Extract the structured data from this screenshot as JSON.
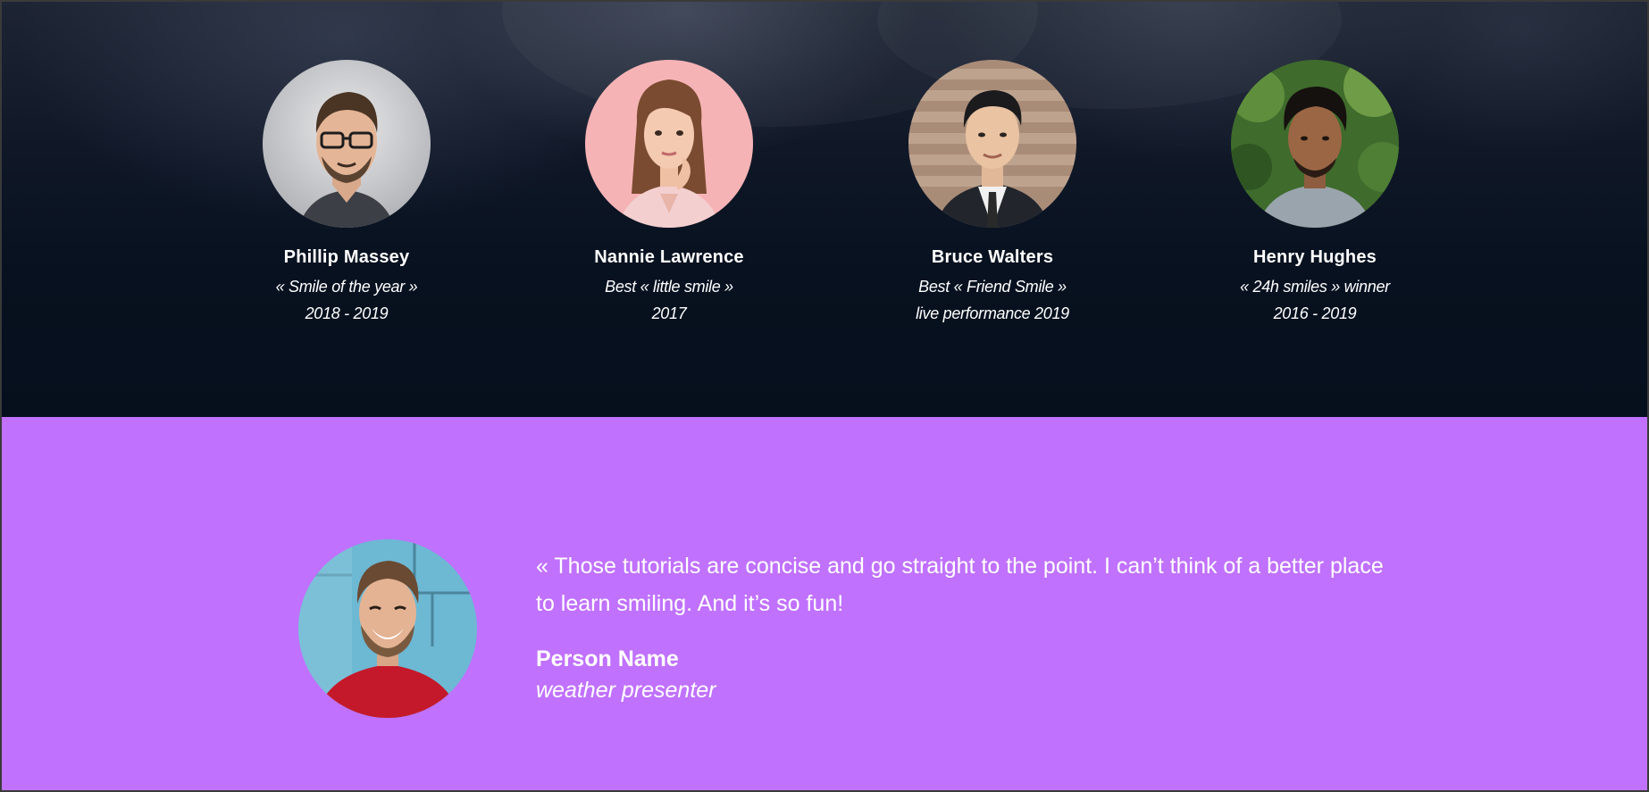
{
  "team": {
    "members": [
      {
        "name": "Phillip Massey",
        "line1": "« Smile of the year »",
        "line2": "2018 - 2019",
        "avatar": "man-with-glasses-photo"
      },
      {
        "name": "Nannie Lawrence",
        "line1": "Best « little smile »",
        "line2": "2017",
        "avatar": "woman-pink-background-photo"
      },
      {
        "name": "Bruce Walters",
        "line1": "Best « Friend Smile »",
        "line2": "live performance 2019",
        "avatar": "man-in-suit-photo"
      },
      {
        "name": "Henry Hughes",
        "line1": "« 24h smiles » winner",
        "line2": "2016 - 2019",
        "avatar": "man-green-background-photo"
      }
    ]
  },
  "testimonial": {
    "quote": "« Those tutorials are concise and go straight to the point. I can’t think of a better place to learn smiling. And it’s so fun!",
    "person_name": "Person Name",
    "person_role": "weather presenter",
    "avatar": "laughing-man-photo",
    "background_color": "#c071fe"
  },
  "colors": {
    "team_background": "#07111f",
    "text": "#ffffff"
  }
}
